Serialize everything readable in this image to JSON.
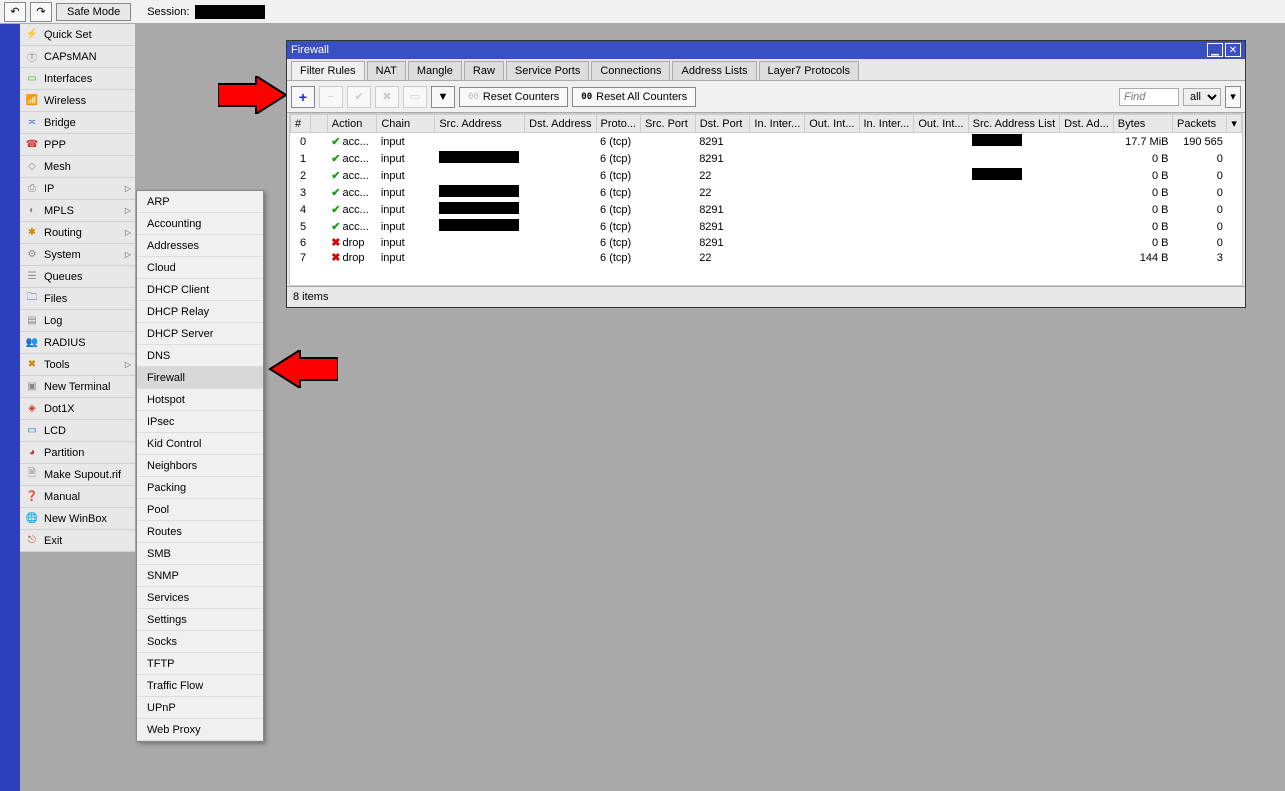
{
  "topbar": {
    "safe_mode": "Safe Mode",
    "session_label": "Session:"
  },
  "menu": [
    {
      "label": "Quick Set",
      "icon": "⚡",
      "cls": "ic-orange"
    },
    {
      "label": "CAPsMAN",
      "icon": "Ⓣ",
      "cls": "ic-gray"
    },
    {
      "label": "Interfaces",
      "icon": "▭",
      "cls": "ic-green"
    },
    {
      "label": "Wireless",
      "icon": "📶",
      "cls": "ic-blue"
    },
    {
      "label": "Bridge",
      "icon": "≍",
      "cls": "ic-blue"
    },
    {
      "label": "PPP",
      "icon": "☎",
      "cls": "ic-red"
    },
    {
      "label": "Mesh",
      "icon": "◇",
      "cls": "ic-gray"
    },
    {
      "label": "IP",
      "icon": "⎙",
      "cls": "ic-gray",
      "arrow": true
    },
    {
      "label": "MPLS",
      "icon": "◐",
      "cls": "ic-gray",
      "arrow": true
    },
    {
      "label": "Routing",
      "icon": "✱",
      "cls": "ic-orange",
      "arrow": true
    },
    {
      "label": "System",
      "icon": "⚙",
      "cls": "ic-gray",
      "arrow": true
    },
    {
      "label": "Queues",
      "icon": "☰",
      "cls": "ic-gray"
    },
    {
      "label": "Files",
      "icon": "🗀",
      "cls": "ic-blue"
    },
    {
      "label": "Log",
      "icon": "▤",
      "cls": "ic-gray"
    },
    {
      "label": "RADIUS",
      "icon": "👥",
      "cls": "ic-red"
    },
    {
      "label": "Tools",
      "icon": "✖",
      "cls": "ic-orange",
      "arrow": true
    },
    {
      "label": "New Terminal",
      "icon": "▣",
      "cls": "ic-gray"
    },
    {
      "label": "Dot1X",
      "icon": "◈",
      "cls": "ic-red"
    },
    {
      "label": "LCD",
      "icon": "▭",
      "cls": "ic-blue"
    },
    {
      "label": "Partition",
      "icon": "◕",
      "cls": "ic-red"
    },
    {
      "label": "Make Supout.rif",
      "icon": "🗎",
      "cls": "ic-gray"
    },
    {
      "label": "Manual",
      "icon": "❓",
      "cls": "ic-orange"
    },
    {
      "label": "New WinBox",
      "icon": "🌐",
      "cls": "ic-blue"
    },
    {
      "label": "Exit",
      "icon": "⎋",
      "cls": "ic-red"
    }
  ],
  "submenu": [
    "ARP",
    "Accounting",
    "Addresses",
    "Cloud",
    "DHCP Client",
    "DHCP Relay",
    "DHCP Server",
    "DNS",
    "Firewall",
    "Hotspot",
    "IPsec",
    "Kid Control",
    "Neighbors",
    "Packing",
    "Pool",
    "Routes",
    "SMB",
    "SNMP",
    "Services",
    "Settings",
    "Socks",
    "TFTP",
    "Traffic Flow",
    "UPnP",
    "Web Proxy"
  ],
  "submenu_highlight": 8,
  "fw": {
    "title": "Firewall",
    "tabs": [
      "Filter Rules",
      "NAT",
      "Mangle",
      "Raw",
      "Service Ports",
      "Connections",
      "Address Lists",
      "Layer7 Protocols"
    ],
    "active_tab": 0,
    "reset_counters": "Reset Counters",
    "reset_all": "Reset All Counters",
    "find_placeholder": "Find",
    "filter_val": "all",
    "columns": [
      "#",
      "",
      "Action",
      "Chain",
      "Src. Address",
      "Dst. Address",
      "Proto...",
      "Src. Port",
      "Dst. Port",
      "In. Inter...",
      "Out. Int...",
      "In. Inter...",
      "Out. Int...",
      "Src. Address List",
      "Dst. Ad...",
      "Bytes",
      "Packets"
    ],
    "rows": [
      {
        "n": "0",
        "action": "acc...",
        "chain": "input",
        "src": "",
        "dst": "",
        "proto": "6 (tcp)",
        "srcp": "",
        "dstp": "8291",
        "saddr": "REDACT",
        "bytes": "17.7 MiB",
        "packets": "190 565",
        "ok": true
      },
      {
        "n": "1",
        "action": "acc...",
        "chain": "input",
        "src": "REDACT",
        "dst": "",
        "proto": "6 (tcp)",
        "srcp": "",
        "dstp": "8291",
        "saddr": "",
        "bytes": "0 B",
        "packets": "0",
        "ok": true
      },
      {
        "n": "2",
        "action": "acc...",
        "chain": "input",
        "src": "",
        "dst": "",
        "proto": "6 (tcp)",
        "srcp": "",
        "dstp": "22",
        "saddr": "REDACT",
        "bytes": "0 B",
        "packets": "0",
        "ok": true
      },
      {
        "n": "3",
        "action": "acc...",
        "chain": "input",
        "src": "REDACT",
        "dst": "",
        "proto": "6 (tcp)",
        "srcp": "",
        "dstp": "22",
        "saddr": "",
        "bytes": "0 B",
        "packets": "0",
        "ok": true
      },
      {
        "n": "4",
        "action": "acc...",
        "chain": "input",
        "src": "REDACT",
        "dst": "",
        "proto": "6 (tcp)",
        "srcp": "",
        "dstp": "8291",
        "saddr": "",
        "bytes": "0 B",
        "packets": "0",
        "ok": true
      },
      {
        "n": "5",
        "action": "acc...",
        "chain": "input",
        "src": "REDACT",
        "dst": "",
        "proto": "6 (tcp)",
        "srcp": "",
        "dstp": "8291",
        "saddr": "",
        "bytes": "0 B",
        "packets": "0",
        "ok": true
      },
      {
        "n": "6",
        "action": "drop",
        "chain": "input",
        "src": "",
        "dst": "",
        "proto": "6 (tcp)",
        "srcp": "",
        "dstp": "8291",
        "saddr": "",
        "bytes": "0 B",
        "packets": "0",
        "ok": false
      },
      {
        "n": "7",
        "action": "drop",
        "chain": "input",
        "src": "",
        "dst": "",
        "proto": "6 (tcp)",
        "srcp": "",
        "dstp": "22",
        "saddr": "",
        "bytes": "144 B",
        "packets": "3",
        "ok": false
      }
    ],
    "status": "8 items"
  }
}
